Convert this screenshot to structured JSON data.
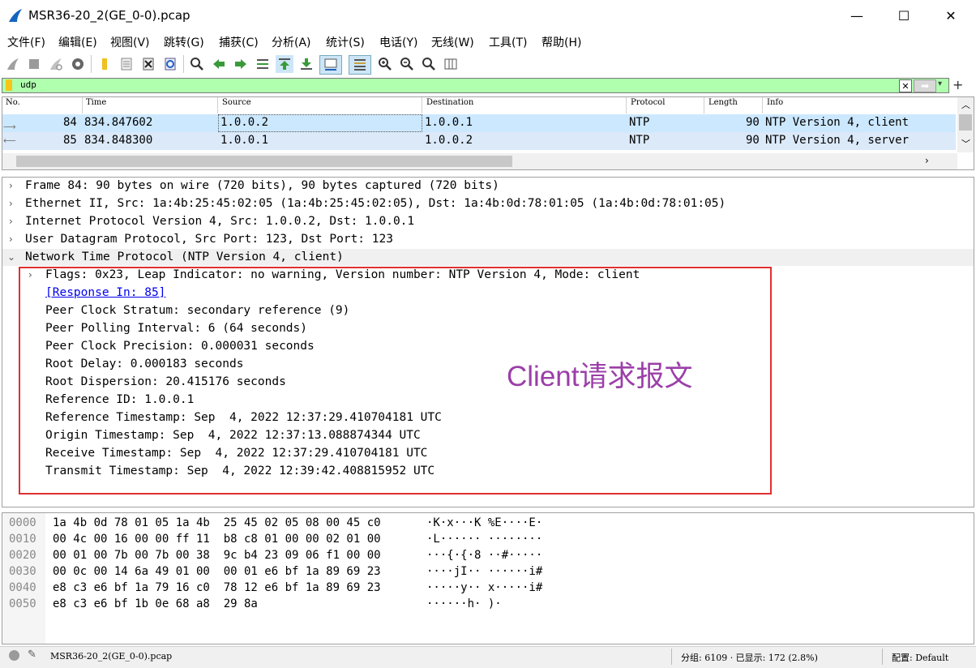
{
  "window": {
    "title": "MSR36-20_2(GE_0-0).pcap",
    "minimize": "—",
    "maximize": "☐",
    "close": "✕"
  },
  "menu": [
    "文件(F)",
    "编辑(E)",
    "视图(V)",
    "跳转(G)",
    "捕获(C)",
    "分析(A)",
    "统计(S)",
    "电话(Y)",
    "无线(W)",
    "工具(T)",
    "帮助(H)"
  ],
  "filter": {
    "value": "udp"
  },
  "packet_list": {
    "columns": [
      "No.",
      "Time",
      "Source",
      "Destination",
      "Protocol",
      "Length",
      "Info"
    ],
    "rows": [
      {
        "no": "84",
        "time": "834.847602",
        "source": "1.0.0.2",
        "destination": "1.0.0.1",
        "protocol": "NTP",
        "length": "90",
        "info": "NTP Version 4, client"
      },
      {
        "no": "85",
        "time": "834.848300",
        "source": "1.0.0.1",
        "destination": "1.0.0.2",
        "protocol": "NTP",
        "length": "90",
        "info": "NTP Version 4, server"
      }
    ]
  },
  "details": {
    "lines": [
      "Frame 84: 90 bytes on wire (720 bits), 90 bytes captured (720 bits)",
      "Ethernet II, Src: 1a:4b:25:45:02:05 (1a:4b:25:45:02:05), Dst: 1a:4b:0d:78:01:05 (1a:4b:0d:78:01:05)",
      "Internet Protocol Version 4, Src: 1.0.0.2, Dst: 1.0.0.1",
      "User Datagram Protocol, Src Port: 123, Dst Port: 123",
      "Network Time Protocol (NTP Version 4, client)"
    ],
    "ntp": {
      "flags": "Flags: 0x23, Leap Indicator: no warning, Version number: NTP Version 4, Mode: client",
      "response_in": "[Response In: 85]",
      "fields": [
        "Peer Clock Stratum: secondary reference (9)",
        "Peer Polling Interval: 6 (64 seconds)",
        "Peer Clock Precision: 0.000031 seconds",
        "Root Delay: 0.000183 seconds",
        "Root Dispersion: 20.415176 seconds",
        "Reference ID: 1.0.0.1",
        "Reference Timestamp: Sep  4, 2022 12:37:29.410704181 UTC",
        "Origin Timestamp: Sep  4, 2022 12:37:13.088874344 UTC",
        "Receive Timestamp: Sep  4, 2022 12:37:29.410704181 UTC",
        "Transmit Timestamp: Sep  4, 2022 12:39:42.408815952 UTC"
      ]
    },
    "annotation": "Client请求报文",
    "annotation_color": "#9b3fa8",
    "box_color": "#e03030"
  },
  "bytes": {
    "offsets": [
      "0000",
      "0010",
      "0020",
      "0030",
      "0040",
      "0050"
    ],
    "hex": [
      "1a 4b 0d 78 01 05 1a 4b  25 45 02 05 08 00 45 c0",
      "00 4c 00 16 00 00 ff 11  b8 c8 01 00 00 02 01 00",
      "00 01 00 7b 00 7b 00 38  9c b4 23 09 06 f1 00 00",
      "00 0c 00 14 6a 49 01 00  00 01 e6 bf 1a 89 69 23",
      "e8 c3 e6 bf 1a 79 16 c0  78 12 e6 bf 1a 89 69 23",
      "e8 c3 e6 bf 1b 0e 68 a8  29 8a"
    ],
    "ascii": [
      "·K·x···K %E····E·",
      "·L······ ········",
      "···{·{·8 ··#·····",
      "····jI·· ······i#",
      "·····y·· x·····i#",
      "······h· )·"
    ]
  },
  "status": {
    "file": "MSR36-20_2(GE_0-0).pcap",
    "packets": "分组: 6109 · 已显示: 172 (2.8%)",
    "profile": "配置: Default"
  },
  "colors": {
    "selected_row": "#cce8ff",
    "alt_row": "#dbe9f9",
    "filter_ok": "#afffaf",
    "link": "#0000ee"
  }
}
